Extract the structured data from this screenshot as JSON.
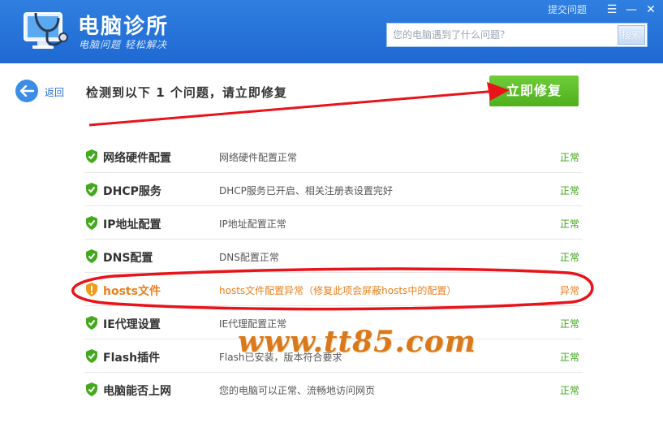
{
  "header": {
    "title": "电脑诊所",
    "subtitle": "电脑问题 轻松解决",
    "feedback": "提交问题",
    "search": {
      "placeholder": "您的电脑遇到了什么问题？",
      "button": "搜索"
    },
    "window_buttons": {
      "menu": "☰",
      "minimize": "—",
      "close": "✕"
    }
  },
  "toolbar": {
    "back_label": "返回",
    "heading": "检测到以下 1 个问题，请立即修复",
    "fix_label": "立即修复"
  },
  "items": [
    {
      "name": "网络硬件配置",
      "desc": "网络硬件配置正常",
      "status": "正常",
      "state": "ok"
    },
    {
      "name": "DHCP服务",
      "desc": "DHCP服务已开启、相关注册表设置完好",
      "status": "正常",
      "state": "ok"
    },
    {
      "name": "IP地址配置",
      "desc": "IP地址配置正常",
      "status": "正常",
      "state": "ok"
    },
    {
      "name": "DNS配置",
      "desc": "DNS配置正常",
      "status": "正常",
      "state": "ok"
    },
    {
      "name": "hosts文件",
      "desc": "hosts文件配置异常（修复此项会屏蔽hosts中的配置）",
      "status": "异常",
      "state": "warn"
    },
    {
      "name": "IE代理设置",
      "desc": "IE代理配置正常",
      "status": "正常",
      "state": "ok"
    },
    {
      "name": "Flash插件",
      "desc": "Flash已安装，版本符合要求",
      "status": "正常",
      "state": "ok"
    },
    {
      "name": "电脑能否上网",
      "desc": "您的电脑可以正常、流畅地访问网页",
      "status": "正常",
      "state": "ok"
    }
  ],
  "watermark": "www.tt85.com",
  "colors": {
    "header": "#1f69d2",
    "ok": "#3fa41a",
    "warn": "#ec7f1c",
    "fix_button": "#52b220",
    "annotation": "#e8141b"
  }
}
